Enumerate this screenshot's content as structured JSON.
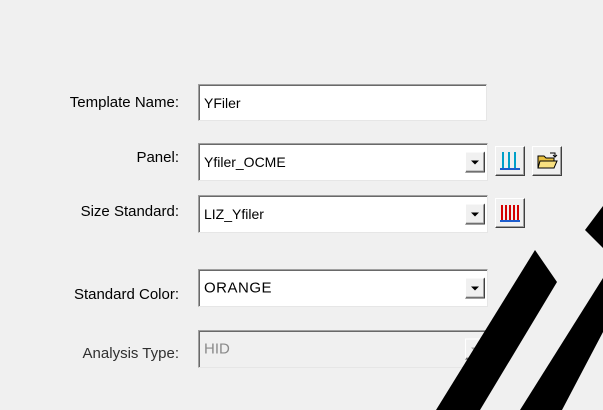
{
  "form": {
    "template_name": {
      "label": "Template Name:",
      "value": "YFiler"
    },
    "panel": {
      "label": "Panel:",
      "value": "Yfiler_OCME"
    },
    "size_standard": {
      "label": "Size Standard:",
      "value": "LIZ_Yfiler"
    },
    "standard_color": {
      "label": "Standard Color:",
      "value": "ORANGE"
    },
    "analysis_type": {
      "label": "Analysis Type:",
      "value": "HID"
    }
  },
  "icons": {
    "panel_editor": "panel-bins-icon",
    "open_folder": "open-folder-icon",
    "size_standard_editor": "size-standard-peaks-icon",
    "dropdown": "chevron-down-icon"
  },
  "colors": {
    "panel_icon": "#00a0c8",
    "size_standard_icon": "#d40000",
    "folder_icon": "#e8c040",
    "watermark": "#000000"
  }
}
